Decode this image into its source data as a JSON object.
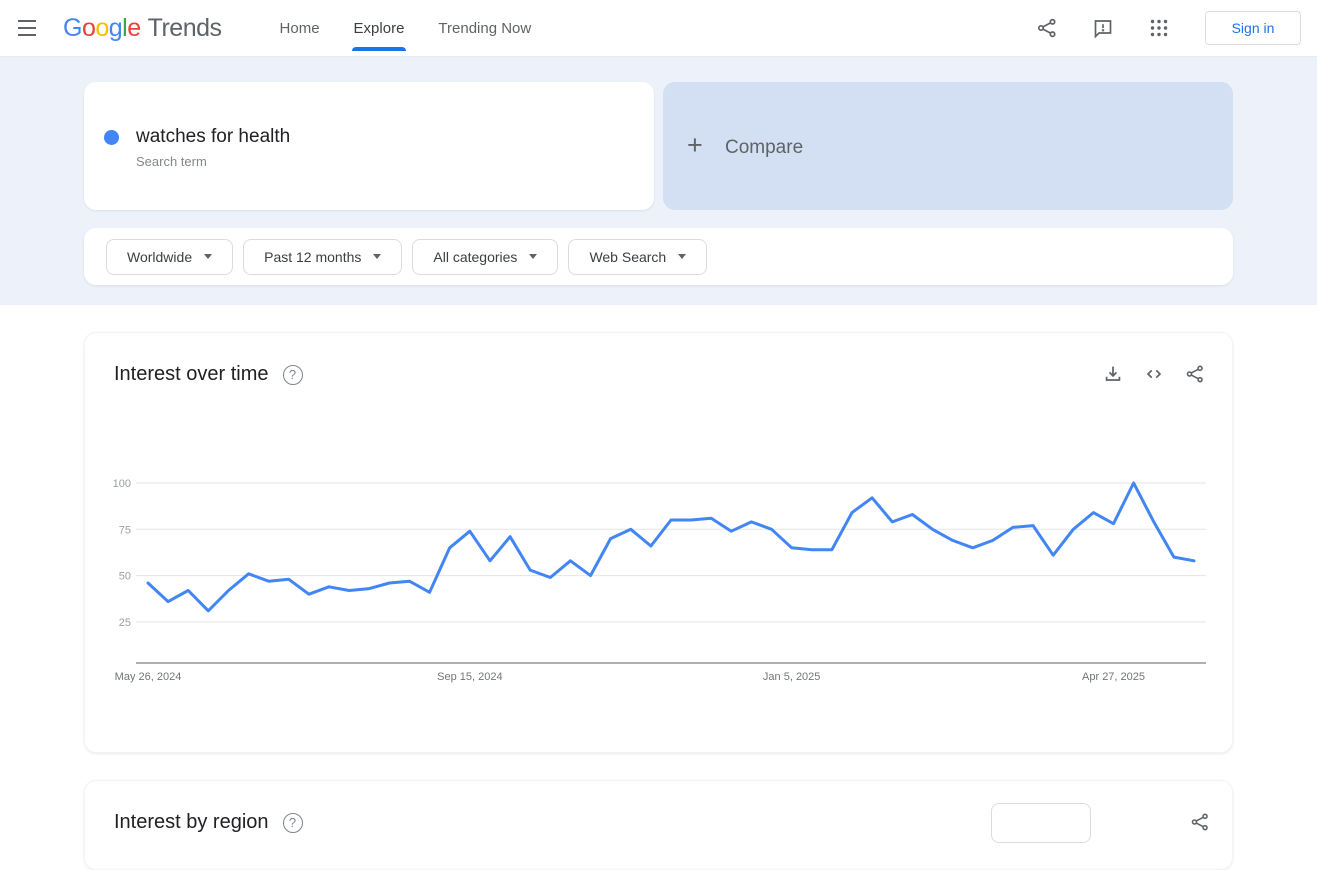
{
  "header": {
    "logo": {
      "brand": "Google",
      "brand_letters": [
        {
          "ch": "G",
          "color": "#4285F4"
        },
        {
          "ch": "o",
          "color": "#EA4335"
        },
        {
          "ch": "o",
          "color": "#FBBC05"
        },
        {
          "ch": "g",
          "color": "#4285F4"
        },
        {
          "ch": "l",
          "color": "#34A853"
        },
        {
          "ch": "e",
          "color": "#EA4335"
        }
      ],
      "product": "Trends"
    },
    "nav": [
      {
        "label": "Home",
        "active": false
      },
      {
        "label": "Explore",
        "active": true
      },
      {
        "label": "Trending Now",
        "active": false
      }
    ],
    "sign_in_label": "Sign in"
  },
  "search_term_card": {
    "term": "watches for health",
    "subtitle": "Search term",
    "dot_color": "#4285f4"
  },
  "compare_card": {
    "plus": "+",
    "label": "Compare",
    "bg_color": "#d3e0f3"
  },
  "filters": [
    {
      "label": "Worldwide"
    },
    {
      "label": "Past 12 months"
    },
    {
      "label": "All categories"
    },
    {
      "label": "Web Search"
    }
  ],
  "interest_over_time": {
    "title": "Interest over time"
  },
  "next_section": {
    "title": "Interest by region"
  },
  "chart_data": {
    "type": "line",
    "title": "Interest over time",
    "x_unit": "week",
    "series": [
      {
        "name": "watches for health",
        "color": "#4285f4",
        "values": [
          46,
          36,
          42,
          31,
          42,
          51,
          47,
          48,
          40,
          44,
          42,
          43,
          46,
          47,
          41,
          65,
          74,
          58,
          71,
          53,
          49,
          58,
          50,
          70,
          75,
          66,
          80,
          80,
          81,
          74,
          79,
          75,
          65,
          64,
          64,
          84,
          92,
          79,
          83,
          75,
          69,
          65,
          69,
          76,
          77,
          61,
          75,
          84,
          78,
          100,
          79,
          60,
          58
        ]
      }
    ],
    "xticks": [
      {
        "label": "May 26, 2024",
        "index": 0
      },
      {
        "label": "Sep 15, 2024",
        "index": 16
      },
      {
        "label": "Jan 5, 2025",
        "index": 32
      },
      {
        "label": "Apr 27, 2025",
        "index": 48
      }
    ],
    "yticks": [
      25,
      50,
      75,
      100
    ],
    "ylim": [
      0,
      100
    ],
    "grid": true,
    "legend": "none"
  }
}
